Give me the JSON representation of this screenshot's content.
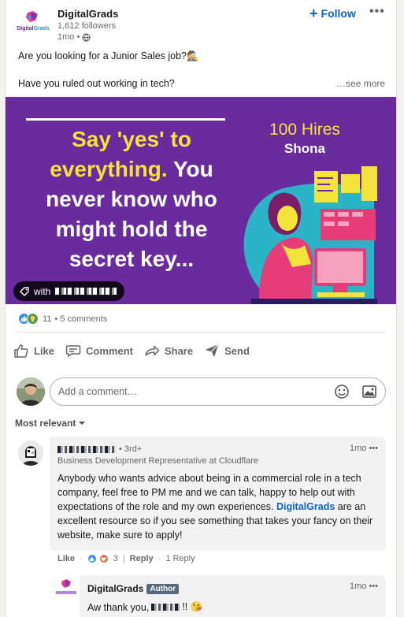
{
  "post": {
    "company": "DigitalGrads",
    "followers": "1,612 followers",
    "age": "1mo •",
    "follow_label": "Follow",
    "line1": "Are you looking for a Junior Sales job?🕵️",
    "line2": "Have you ruled out working in tech?",
    "see_more": "…see more"
  },
  "logo": {
    "word_part1": "Digital",
    "word_part2": "Grads"
  },
  "banner": {
    "quote_yellow": "Say 'yes' to everything.",
    "quote_white": "You never know who might hold the secret key...",
    "hires": "100 Hires",
    "name": "Shona",
    "tag_prefix": "with",
    "colors": {
      "background": "#6a2b9e",
      "accent": "#f3e33b"
    }
  },
  "social": {
    "reaction_count": "11",
    "comments": "• 5 comments"
  },
  "actions": {
    "like": "Like",
    "comment": "Comment",
    "share": "Share",
    "send": "Send"
  },
  "comment_box": {
    "placeholder": "Add a comment…"
  },
  "sort": {
    "label": "Most relevant"
  },
  "comment1": {
    "degree": "• 3rd+",
    "headline": "Business Development Representative at Cloudflare",
    "time": "1mo •••",
    "body_part1": "Anybody who wants advice about being in a commercial role in a tech company, feel free to PM me and we can talk, happy to help out with expectations of the role and my own experiences.",
    "mention": "DigitalGrads",
    "body_part2": "are an excellent resource so if you see something that takes your fancy on their website, make sure to apply!",
    "like_label": "Like",
    "reaction_count": "3",
    "reply_label": "Reply",
    "replies": "1 Reply"
  },
  "reply1": {
    "name": "DigitalGrads",
    "badge": "Author",
    "time": "1mo •••",
    "prefix": "Aw thank you,",
    "suffix": "!! 😘"
  },
  "colors": {
    "link": "#0a66c2",
    "like": "#378fe9",
    "love": "#df704d"
  }
}
